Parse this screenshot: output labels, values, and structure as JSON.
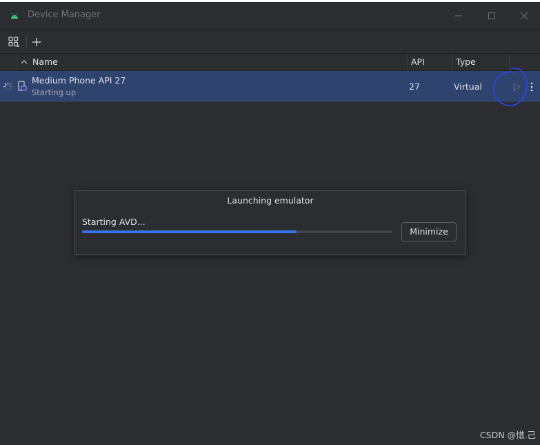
{
  "window": {
    "title": "Device Manager",
    "controls": [
      "minimize-icon",
      "maximize-icon",
      "close-icon"
    ]
  },
  "toolbar": {
    "icons": [
      "device-grid-icon",
      "add-icon"
    ]
  },
  "table": {
    "columns": {
      "name": "Name",
      "api": "API",
      "type": "Type"
    },
    "sort_icon": "chevron-up-icon",
    "rows": [
      {
        "name": "Medium Phone API 27",
        "status": "Starting up",
        "api": "27",
        "type": "Virtual",
        "icons": [
          "spinner-icon",
          "phone-icon",
          "play-icon",
          "more-vertical-icon"
        ]
      }
    ]
  },
  "dialog": {
    "title": "Launching emulator",
    "status": "Starting AVD...",
    "progress": 0.69,
    "minimize_label": "Minimize"
  },
  "watermark": "CSDN @惜.己",
  "colors": {
    "background": "#2b2d30",
    "selected_row": "#2e436e",
    "accent": "#3574f0",
    "annotation": "#2b45e8"
  }
}
